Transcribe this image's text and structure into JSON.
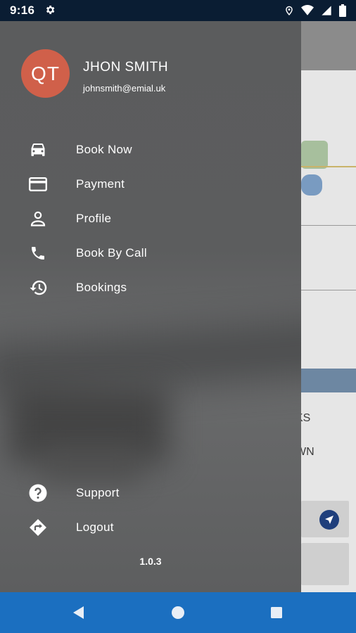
{
  "status_bar": {
    "time": "9:16",
    "icons": [
      "gear-icon",
      "location-icon",
      "wifi-icon",
      "signal-icon",
      "battery-icon"
    ]
  },
  "drawer": {
    "avatar_initials": "QT",
    "user_name": "JHON SMITH",
    "user_email": "johnsmith@emial.uk",
    "menu": [
      {
        "label": "Book Now",
        "icon": "car-icon"
      },
      {
        "label": "Payment",
        "icon": "credit-card-icon"
      },
      {
        "label": "Profile",
        "icon": "person-icon"
      },
      {
        "label": "Book By Call",
        "icon": "phone-icon"
      },
      {
        "label": "Bookings",
        "icon": "history-icon"
      }
    ],
    "bottom_menu": [
      {
        "label": "Support",
        "icon": "help-icon"
      },
      {
        "label": "Logout",
        "icon": "directions-icon"
      }
    ],
    "version": "1.0.3"
  },
  "map": {
    "label_1": "KS",
    "label_2": "WN"
  },
  "colors": {
    "status_bar": "#0a1d33",
    "avatar": "#d0604a",
    "nav_bar": "#1b6fc0"
  }
}
